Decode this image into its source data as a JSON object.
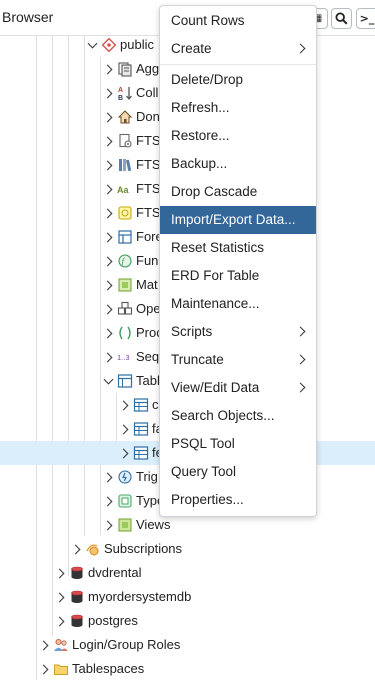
{
  "header": {
    "title": "Browser"
  },
  "tree": [
    {
      "id": "public",
      "label": "public",
      "state": "open",
      "icon": "schema-icon"
    },
    {
      "id": "aggregates",
      "label": "Agg",
      "state": "closed",
      "icon": "aggregate-icon"
    },
    {
      "id": "collations",
      "label": "Coll",
      "state": "closed",
      "icon": "collation-icon"
    },
    {
      "id": "domains",
      "label": "Don",
      "state": "closed",
      "icon": "domain-icon"
    },
    {
      "id": "fts-config",
      "label": "FTS",
      "state": "closed",
      "icon": "fts-configuration-icon"
    },
    {
      "id": "fts-dict",
      "label": "FTS",
      "state": "closed",
      "icon": "fts-dictionary-icon"
    },
    {
      "id": "fts-parser",
      "label": "FTS",
      "state": "closed",
      "icon": "fts-parser-icon"
    },
    {
      "id": "fts-template",
      "label": "FTS",
      "state": "closed",
      "icon": "fts-template-icon"
    },
    {
      "id": "foreign-tables",
      "label": "Fore",
      "state": "closed",
      "icon": "foreign-table-icon"
    },
    {
      "id": "functions",
      "label": "Func",
      "state": "closed",
      "icon": "function-icon"
    },
    {
      "id": "mat-views",
      "label": "Mat",
      "state": "closed",
      "icon": "materialized-view-icon"
    },
    {
      "id": "operators",
      "label": "Ope",
      "state": "closed",
      "icon": "operator-icon"
    },
    {
      "id": "procedures",
      "label": "Proc",
      "state": "closed",
      "icon": "procedure-icon"
    },
    {
      "id": "sequences",
      "label": "Seq",
      "state": "closed",
      "icon": "sequence-icon"
    },
    {
      "id": "tables",
      "label": "Tabl",
      "state": "open",
      "icon": "tables-icon"
    },
    {
      "id": "table-c",
      "label": "c",
      "state": "closed",
      "icon": "table-icon"
    },
    {
      "id": "table-f1",
      "label": "fa",
      "state": "closed",
      "icon": "table-icon"
    },
    {
      "id": "table-f2",
      "label": "fe",
      "state": "closed",
      "icon": "table-icon",
      "selected": true
    },
    {
      "id": "triggers",
      "label": "Trig",
      "state": "closed",
      "icon": "trigger-function-icon"
    },
    {
      "id": "types",
      "label": "Type",
      "state": "closed",
      "icon": "type-icon"
    },
    {
      "id": "views",
      "label": "Views",
      "state": "closed",
      "icon": "view-icon"
    },
    {
      "id": "subscriptions",
      "label": "Subscriptions",
      "state": "closed",
      "icon": "subscription-icon"
    },
    {
      "id": "dvdrental",
      "label": "dvdrental",
      "state": "closed",
      "icon": "database-icon"
    },
    {
      "id": "myordersystemdb",
      "label": "myordersystemdb",
      "state": "closed",
      "icon": "database-icon"
    },
    {
      "id": "postgres",
      "label": "postgres",
      "state": "closed",
      "icon": "database-icon"
    },
    {
      "id": "login-roles",
      "label": "Login/Group Roles",
      "state": "closed",
      "icon": "roles-icon"
    },
    {
      "id": "tablespaces",
      "label": "Tablespaces",
      "state": "closed",
      "icon": "tablespace-icon"
    }
  ],
  "menu": [
    {
      "label": "Count Rows"
    },
    {
      "label": "Create",
      "submenu": true
    },
    {
      "sep": true
    },
    {
      "label": "Delete/Drop"
    },
    {
      "label": "Refresh..."
    },
    {
      "label": "Restore..."
    },
    {
      "label": "Backup..."
    },
    {
      "label": "Drop Cascade"
    },
    {
      "label": "Import/Export Data...",
      "active": true
    },
    {
      "label": "Reset Statistics"
    },
    {
      "label": "ERD For Table"
    },
    {
      "label": "Maintenance..."
    },
    {
      "label": "Scripts",
      "submenu": true
    },
    {
      "label": "Truncate",
      "submenu": true
    },
    {
      "label": "View/Edit Data",
      "submenu": true
    },
    {
      "label": "Search Objects..."
    },
    {
      "label": "PSQL Tool"
    },
    {
      "label": "Query Tool"
    },
    {
      "label": "Properties..."
    }
  ],
  "colors": {
    "accent": "#336699",
    "selection": "#dbeefb"
  }
}
